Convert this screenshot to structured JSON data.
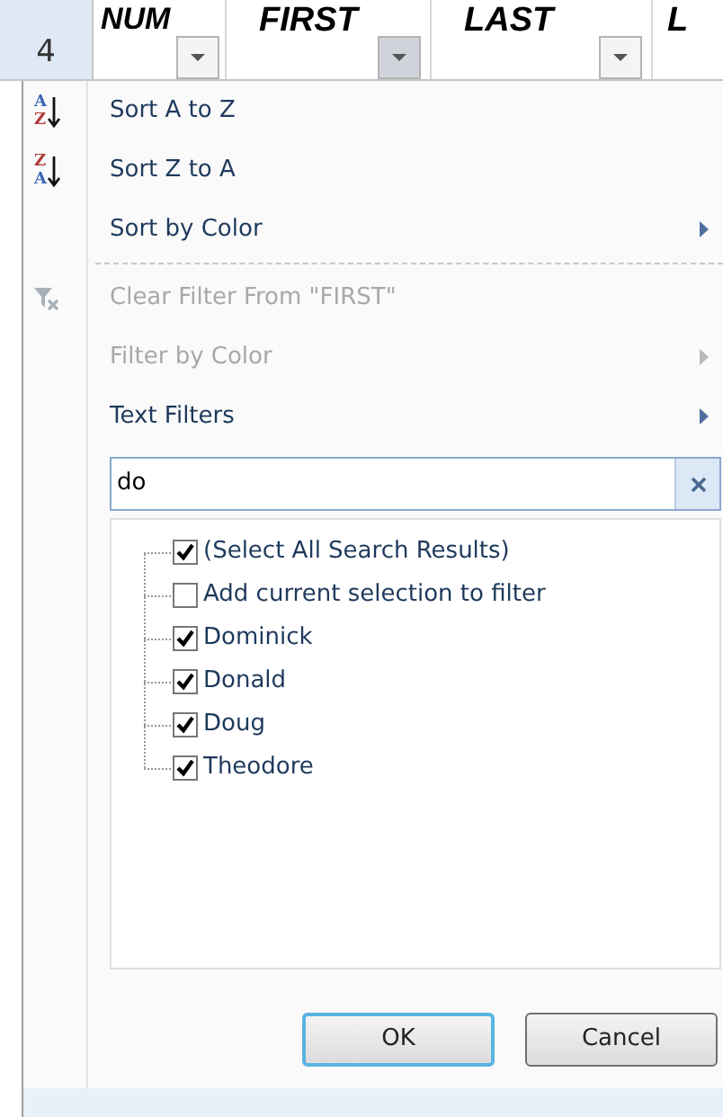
{
  "row_header": "4",
  "columns": [
    {
      "label": "NUM",
      "active": false
    },
    {
      "label": "FIRST",
      "active": true
    },
    {
      "label": "LAST",
      "active": false
    },
    {
      "label": "L"
    }
  ],
  "menu": {
    "groups": [
      [
        {
          "kind": "sort_asc",
          "icon_letters": [
            "A",
            "Z"
          ],
          "label": "Sort A to Z",
          "disabled": false,
          "submenu": false
        },
        {
          "kind": "sort_desc",
          "icon_letters": [
            "Z",
            "A"
          ],
          "label": "Sort Z to A",
          "disabled": false,
          "submenu": false
        },
        {
          "kind": "plain",
          "label": "Sort by Color",
          "disabled": false,
          "submenu": true
        }
      ],
      [
        {
          "kind": "clear_filter",
          "label": "Clear Filter From \"FIRST\"",
          "disabled": true,
          "submenu": false
        },
        {
          "kind": "plain",
          "label": "Filter by Color",
          "disabled": true,
          "submenu": true
        },
        {
          "kind": "plain",
          "label": "Text Filters",
          "disabled": false,
          "submenu": true
        }
      ]
    ],
    "search": {
      "value": "do"
    },
    "tree": [
      {
        "label": "(Select All Search Results)",
        "checked": true
      },
      {
        "label": "Add current selection to filter",
        "checked": false
      },
      {
        "label": "Dominick",
        "checked": true
      },
      {
        "label": "Donald",
        "checked": true
      },
      {
        "label": "Doug",
        "checked": true
      },
      {
        "label": "Theodore",
        "checked": true
      }
    ],
    "buttons": [
      {
        "label": "OK",
        "default": true
      },
      {
        "label": "Cancel",
        "default": false
      }
    ]
  }
}
